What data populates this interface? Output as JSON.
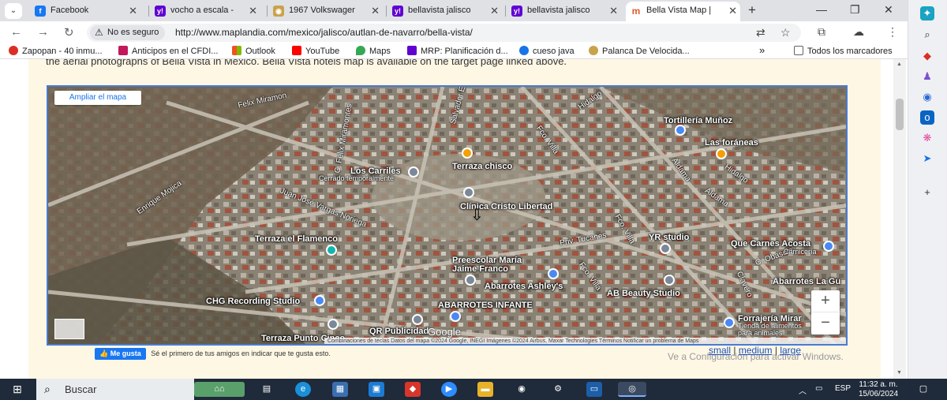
{
  "tabs": [
    {
      "title": "Facebook",
      "icon": "facebook-icon",
      "color": "#1877f2",
      "glyph": "f"
    },
    {
      "title": "vocho a escala -",
      "icon": "yahoo-icon",
      "color": "#6001d2",
      "glyph": "y!"
    },
    {
      "title": "1967 Volkswager",
      "icon": "car-icon",
      "color": "#c8a34a",
      "glyph": "◉"
    },
    {
      "title": "bellavista jalisco",
      "icon": "yahoo-icon",
      "color": "#6001d2",
      "glyph": "y!"
    },
    {
      "title": "bellavista jalisco",
      "icon": "yahoo-icon",
      "color": "#6001d2",
      "glyph": "y!"
    },
    {
      "title": "Bella Vista Map |",
      "icon": "maplandia-icon",
      "color": "#e25b2a",
      "glyph": "m"
    }
  ],
  "address": {
    "security": "No es seguro",
    "url": "http://www.maplandia.com/mexico/jalisco/autlan-de-navarro/bella-vista/"
  },
  "bookmarks": [
    {
      "label": "Zapopan - 40 inmu...",
      "color": "#d93025"
    },
    {
      "label": "Anticipos en el CFDI...",
      "color": "#c2185b"
    },
    {
      "label": "Outlook",
      "color": "#f25022"
    },
    {
      "label": "YouTube",
      "color": "#ff0000"
    },
    {
      "label": "Maps",
      "color": "#34a853"
    },
    {
      "label": "MRP: Planificación d...",
      "color": "#6001d2"
    },
    {
      "label": "cueso java",
      "color": "#1a73e8"
    },
    {
      "label": "Palanca De Velocida...",
      "color": "#c8a34a"
    }
  ],
  "bookmarks_overflow": "»",
  "all_bookmarks": "Todos los marcadores",
  "page": {
    "intro": "the aerial photographs of Bella Vista in Mexico. Bella Vista hotels map is available on the target page linked above.",
    "map": {
      "enlarge": "Ampliar el mapa",
      "zoom_in": "+",
      "zoom_out": "−",
      "attribution": "Combinaciones de teclas   Datos del mapa ©2024 Google, INEGI Imágenes ©2024 Airbus, Maxar Technologies   Términos   Notificar un problema de Maps",
      "google": "Google",
      "places": {
        "los_carriles": "Los Carriles",
        "cerrado": "Cerrado temporalmente",
        "terraza_chisco": "Terraza chisco",
        "clinica": "Clínica Cristo Libertad",
        "tortilleria": "Tortillería Muñoz",
        "foraneas": "Las foráneas",
        "terraza_flamenco": "Terraza el Flamenco",
        "preescolar": "Preescolar María",
        "preescolar2": "Jaime Franco",
        "abarrotes_ashley": "Abarrotes Ashley's",
        "chg": "CHG Recording Studio",
        "abarrotes_infante": "ABARROTES INFANTE",
        "qr": "QR Publicidad",
        "terraza_punto": "Terraza Punto Cinco",
        "yr": "YR studio",
        "ab_beauty": "AB Beauty Studio",
        "que_carnes": "Que Carnes Acosta",
        "carniceria": "Carnicería",
        "abarrotes_la": "Abarrotes La Gu",
        "forrajeria": "Forrajería Mirar",
        "tienda": "Tienda de alimentos",
        "para_animales": "para animales"
      },
      "streets": {
        "felix": "Felix Miramon",
        "c_felix": "C. Felix Miramontes",
        "salvador": "Salvador E",
        "enrique": "Enrique Mojica",
        "juan": "Juan José Vargas Noriega",
        "priv": "Priv. Tucanes",
        "fco_villa1": "Fco. Villa",
        "fco_villa2": "Fco. Villa",
        "fco_villa3": "Fco. Villa",
        "hidalgo1": "Hidalgo",
        "hidalgo2": "Hidalgo",
        "aldama1": "Aldama",
        "aldama2": "Aldama",
        "obasolo": "C. Obasolo",
        "clavero": "Clavero"
      }
    },
    "like": {
      "button": "Me gusta",
      "text": "Sé el primero de tus amigos en indicar que te gusta esto."
    },
    "sizes": {
      "small": "small",
      "medium": "medium",
      "large": "large",
      "sep": "|"
    },
    "activate": "Ve a Configuración para activar Windows."
  },
  "taskbar": {
    "search": "Buscar",
    "lang": "ESP",
    "time": "11:32 a. m.",
    "date": "15/06/2024"
  }
}
